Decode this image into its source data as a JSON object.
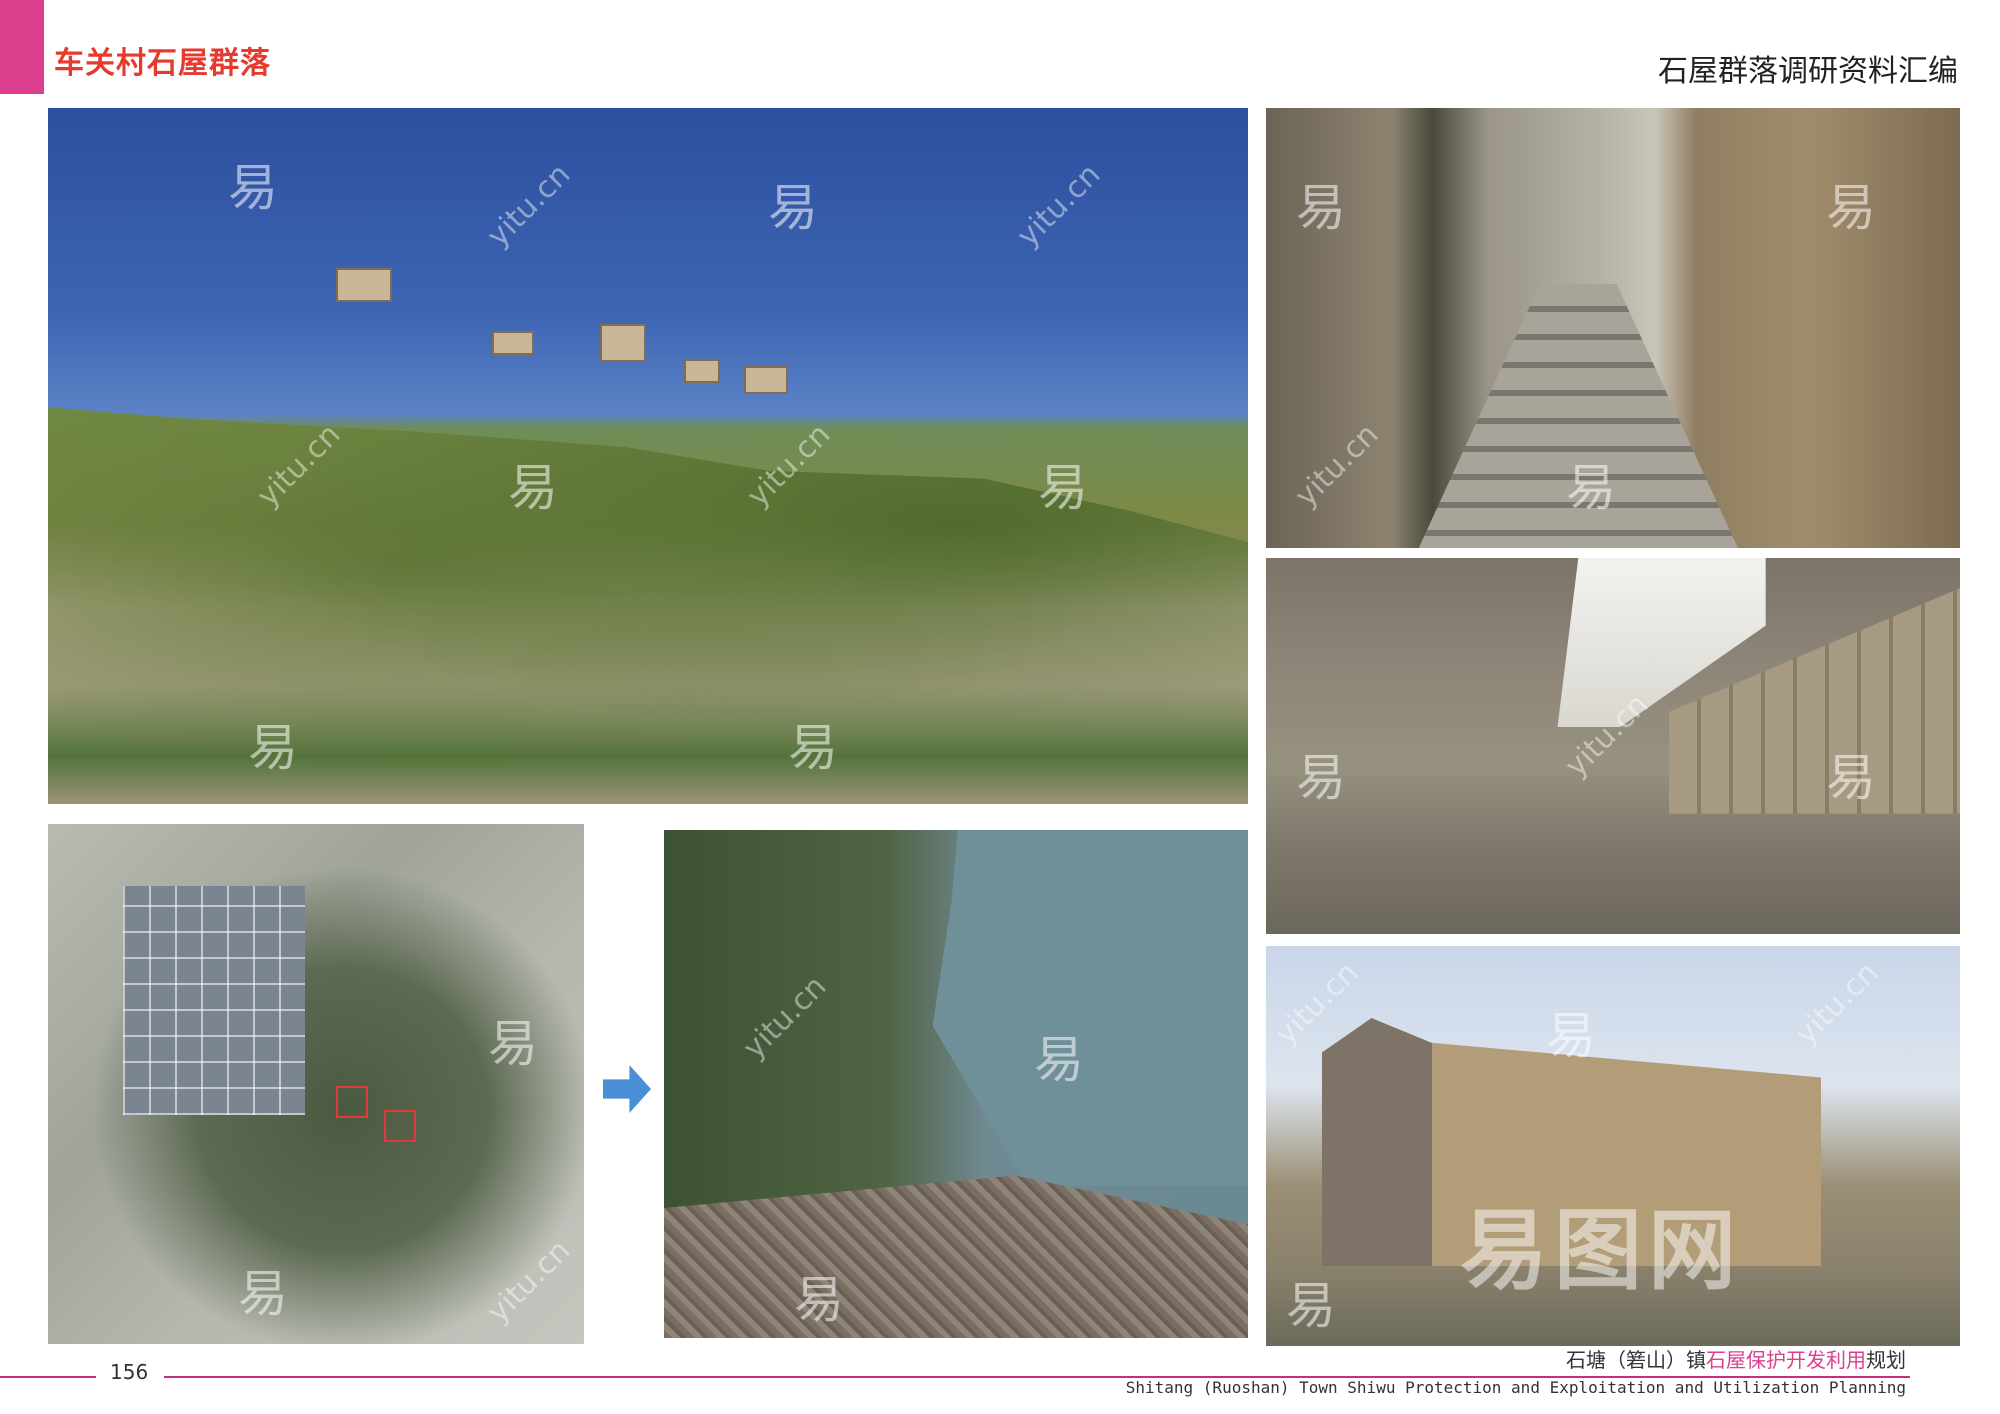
{
  "header": {
    "left_title": "车关村石屋群落",
    "right_title": "石屋群落调研资料汇编"
  },
  "colors": {
    "accent": "#dd3f8f",
    "title_red": "#e63a2e",
    "arrow_blue": "#4a8fd6",
    "footer_line": "#c2307e"
  },
  "watermarks": {
    "char": "易",
    "url": "yitu.cn",
    "brand": "易图网"
  },
  "footer": {
    "page_number": "156",
    "cn_prefix": "石塘（箬山）镇",
    "cn_highlight": "石屋保护开发利用",
    "cn_suffix": "规划",
    "en_title": "Shitang (Ruoshan) Town Shiwu Protection and Exploitation and Utilization Planning"
  }
}
